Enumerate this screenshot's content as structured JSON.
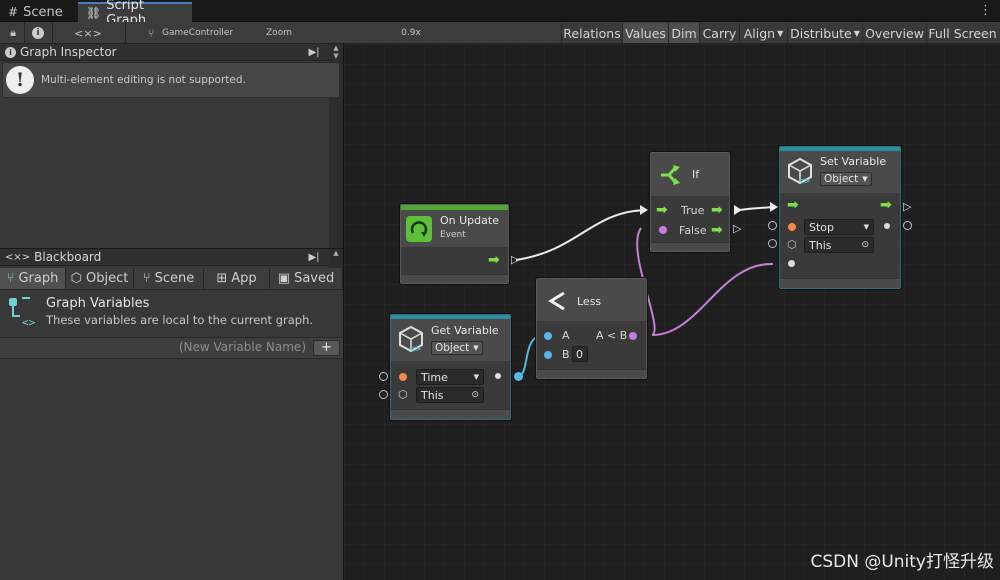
{
  "tabs": [
    {
      "label": "Scene",
      "icon": "grid-icon"
    },
    {
      "label": "Script Graph",
      "icon": "script-graph-icon"
    }
  ],
  "toolbar": {
    "breadcrumb": "GameController",
    "zoom_label": "Zoom",
    "zoom_value": "0.9x",
    "zoom_level": 0.9,
    "buttons": [
      "Relations",
      "Values",
      "Dim",
      "Carry",
      "Align",
      "Distribute",
      "Overview",
      "Full Screen"
    ],
    "active_buttons": [
      "Values",
      "Dim"
    ]
  },
  "inspector": {
    "title": "Graph Inspector",
    "message": "Multi-element editing is not supported."
  },
  "blackboard": {
    "title": "Blackboard",
    "tabs": [
      "Graph",
      "Object",
      "Scene",
      "App",
      "Saved"
    ],
    "active_tab": "Graph",
    "section_title": "Graph Variables",
    "section_desc": "These variables are local to the current graph.",
    "new_var_placeholder": "(New Variable Name)",
    "add_label": "+"
  },
  "nodes": {
    "on_update": {
      "title": "On Update",
      "subtitle": "Event"
    },
    "if": {
      "title": "If",
      "true_label": "True",
      "false_label": "False"
    },
    "set_variable": {
      "title": "Set Variable",
      "kind": "Object",
      "name_value": "Stop",
      "target_value": "This"
    },
    "less": {
      "title": "Less",
      "a_label": "A",
      "b_label": "B",
      "b_value": "0",
      "out_label": "A < B"
    },
    "get_variable": {
      "title": "Get Variable",
      "kind": "Object",
      "name_value": "Time",
      "target_value": "This"
    }
  },
  "colors": {
    "flow": "#7de04a",
    "float": "#5ab4e6",
    "bool": "#c77ddb",
    "variable": "#f08a4b",
    "header_green": "#4fa830",
    "header_teal": "#2a8fa1"
  },
  "watermark": "CSDN @Unity打怪升级"
}
